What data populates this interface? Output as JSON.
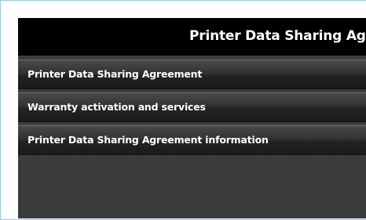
{
  "title_bar": {
    "title": "Printer Data Sharing Agre"
  },
  "menu": {
    "items": [
      {
        "label": "Printer Data Sharing Agreement"
      },
      {
        "label": "Warranty activation and services"
      },
      {
        "label": "Printer Data Sharing Agreement information"
      }
    ]
  },
  "colors": {
    "frame_border": "#8fd0e6",
    "title_bar_bg": "#000000",
    "menu_item_bg": "#2a2a2a",
    "screen_bg": "#3a3d3c",
    "text": "#ffffff"
  }
}
